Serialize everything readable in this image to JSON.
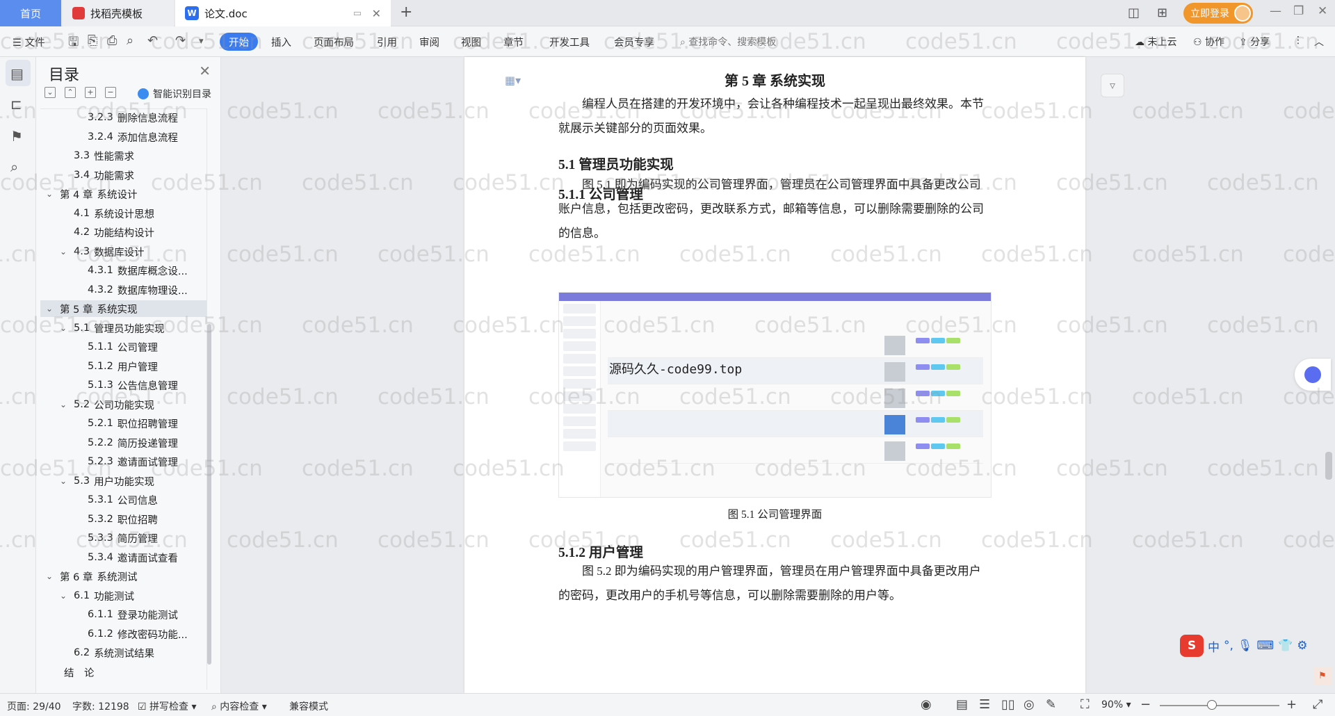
{
  "tabs": {
    "home": "首页",
    "find": "找稻壳模板",
    "doc": "论文.doc"
  },
  "login": "立即登录",
  "menu": {
    "file": "文件",
    "items": [
      "开始",
      "插入",
      "页面布局",
      "引用",
      "审阅",
      "视图",
      "章节",
      "开发工具",
      "会员专享"
    ],
    "search": "查找命令、搜索模板",
    "cloud": "未上云",
    "collab": "协作",
    "share": "分享"
  },
  "toc": {
    "title": "目录",
    "smart": "智能识别目录",
    "items": [
      {
        "num": "3.2.3",
        "text": "删除信息流程"
      },
      {
        "num": "3.2.4",
        "text": "添加信息流程"
      },
      {
        "num": "3.3",
        "text": "性能需求"
      },
      {
        "num": "3.4",
        "text": "功能需求"
      },
      {
        "num": "第 4 章",
        "text": "系统设计"
      },
      {
        "num": "4.1",
        "text": "系统设计思想"
      },
      {
        "num": "4.2",
        "text": "功能结构设计"
      },
      {
        "num": "4.3",
        "text": "数据库设计"
      },
      {
        "num": "4.3.1",
        "text": "数据库概念设..."
      },
      {
        "num": "4.3.2",
        "text": "数据库物理设..."
      },
      {
        "num": "第 5 章",
        "text": "系统实现"
      },
      {
        "num": "5.1",
        "text": "管理员功能实现"
      },
      {
        "num": "5.1.1",
        "text": "公司管理"
      },
      {
        "num": "5.1.2",
        "text": "用户管理"
      },
      {
        "num": "5.1.3",
        "text": "公告信息管理"
      },
      {
        "num": "5.2",
        "text": "公司功能实现"
      },
      {
        "num": "5.2.1",
        "text": "职位招聘管理"
      },
      {
        "num": "5.2.2",
        "text": "简历投递管理"
      },
      {
        "num": "5.2.3",
        "text": "邀请面试管理"
      },
      {
        "num": "5.3",
        "text": "用户功能实现"
      },
      {
        "num": "5.3.1",
        "text": "公司信息"
      },
      {
        "num": "5.3.2",
        "text": "职位招聘"
      },
      {
        "num": "5.3.3",
        "text": "简历管理"
      },
      {
        "num": "5.3.4",
        "text": "邀请面试查看"
      },
      {
        "num": "第 6 章",
        "text": "系统测试"
      },
      {
        "num": "6.1",
        "text": "功能测试"
      },
      {
        "num": "6.1.1",
        "text": "登录功能测试"
      },
      {
        "num": "6.1.2",
        "text": "修改密码功能..."
      },
      {
        "num": "6.2",
        "text": "系统测试结果"
      },
      {
        "num": "",
        "text": "结　论"
      }
    ]
  },
  "doc": {
    "chapter": "第 5 章  系统实现",
    "intro": "编程人员在搭建的开发环境中，会让各种编程技术一起呈现出最终效果。本节就展示关键部分的页面效果。",
    "h_51": "5.1  管理员功能实现",
    "h_511": "5.1.1  公司管理",
    "p_511": "图 5.1 即为编码实现的公司管理界面，管理员在公司管理界面中具备更改公司账户信息，包括更改密码，更改联系方式，邮箱等信息，可以删除需要删除的公司的信息。",
    "figure_watermark": "源码久久-code99.top",
    "caption": "图 5.1 公司管理界面",
    "h_512": "5.1.2  用户管理",
    "p_512": "图 5.2 即为编码实现的用户管理界面，管理员在用户管理界面中具备更改用户的密码，更改用户的手机号等信息，可以删除需要删除的用户等。"
  },
  "watermark": "code51.cn",
  "ime": {
    "lang": "中"
  },
  "status": {
    "page": "页面: 29/40",
    "words": "字数: 12198",
    "spell": "拼写检查",
    "content": "内容检查",
    "compat": "兼容模式",
    "zoom": "90%"
  },
  "colors": {
    "accent": "#3a7bf0",
    "login": "#f0962a",
    "home_tab": "#5b8def"
  }
}
